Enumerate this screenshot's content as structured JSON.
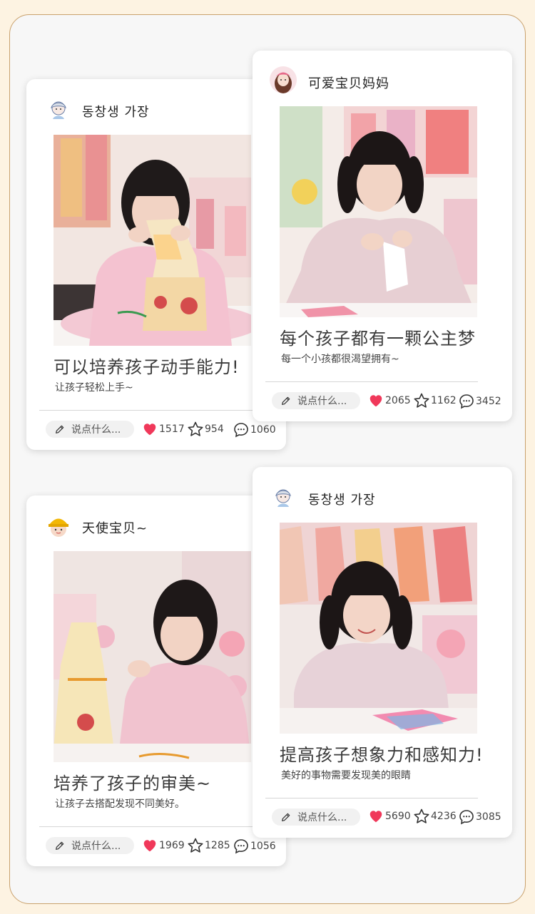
{
  "posts": [
    {
      "user": "동창생 가장",
      "title": "可以培养孩子动手能力!",
      "subtitle": "让孩子轻松上手~",
      "comment_placeholder": "说点什么...",
      "likes": "1517",
      "stars": "954",
      "comments": "1060"
    },
    {
      "user": "可爱宝贝妈妈",
      "title": "每个孩子都有一颗公主梦",
      "subtitle": "每一个小孩都很渴望拥有~",
      "comment_placeholder": "说点什么...",
      "likes": "2065",
      "stars": "1162",
      "comments": "3452"
    },
    {
      "user": "天使宝贝~",
      "title": "培养了孩子的审美~",
      "subtitle": "让孩子去搭配发现不同美好。",
      "comment_placeholder": "说点什么...",
      "likes": "1969",
      "stars": "1285",
      "comments": "1056"
    },
    {
      "user": "동창생 가장",
      "title": "提高孩子想象力和感知力!",
      "subtitle": "美好的事物需要发现美的眼睛",
      "comment_placeholder": "说点什么...",
      "likes": "5690",
      "stars": "4236",
      "comments": "3085"
    }
  ],
  "colors": {
    "heart": "#f0385a",
    "border": "#c9a16c",
    "background": "#fdf3e2"
  }
}
